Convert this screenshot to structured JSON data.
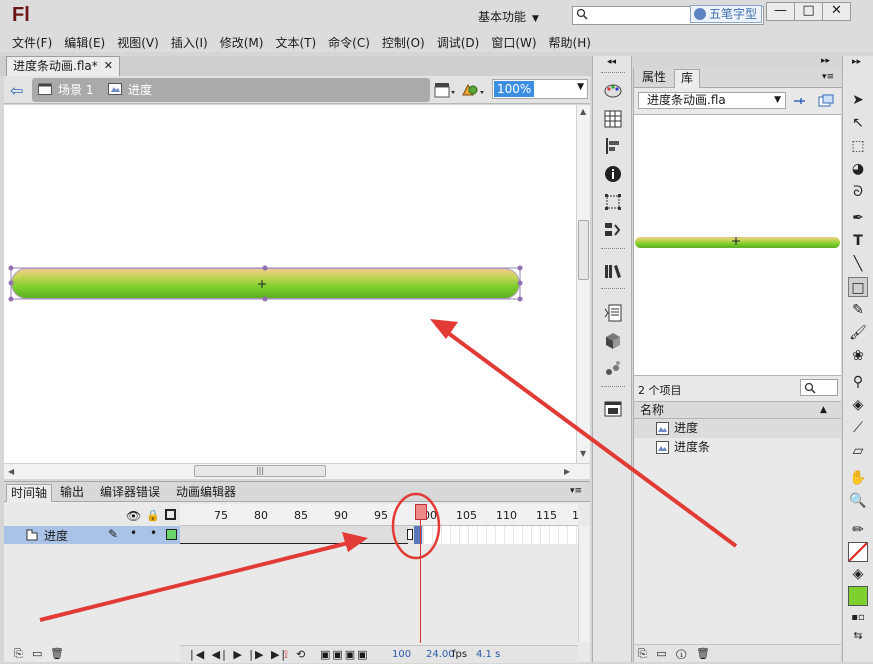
{
  "app": {
    "logo": "Fl",
    "workspace_label": "基本功能",
    "ime_label": "五笔字型",
    "window_buttons": {
      "minimize": "—",
      "restore": "□",
      "close": "✕"
    }
  },
  "menu": [
    "文件(F)",
    "编辑(E)",
    "视图(V)",
    "插入(I)",
    "修改(M)",
    "文本(T)",
    "命令(C)",
    "控制(O)",
    "调试(D)",
    "窗口(W)",
    "帮助(H)"
  ],
  "document": {
    "tab_label": "进度条动画.fla*",
    "tab_close": "✕",
    "breadcrumb": {
      "scene": "场景 1",
      "symbol": "进度"
    },
    "zoom": "100%"
  },
  "timeline": {
    "tabs": [
      "时间轴",
      "输出",
      "编译器错误",
      "动画编辑器"
    ],
    "ruler_ticks": [
      "75",
      "80",
      "85",
      "90",
      "95",
      "100",
      "105",
      "110",
      "115",
      "1"
    ],
    "layer_name": "进度",
    "current_frame": "100",
    "fps": "24.00",
    "fps_unit": "fps",
    "elapsed": "4.1 s"
  },
  "library": {
    "tabs": [
      "属性",
      "库"
    ],
    "document_select": "进度条动画.fla",
    "item_count": "2 个项目",
    "column_header": "名称",
    "items": [
      "进度",
      "进度条"
    ]
  },
  "colors": {
    "accent_blue": "#3b8ee0",
    "layer_highlight": "#a9c3e6",
    "playhead": "#ee8a8a",
    "annotation_red": "#e23b36",
    "bar_green": "#7fcf2e",
    "bar_top": "#f0c98a"
  },
  "icons": {
    "back": "back-arrow-icon",
    "scene": "scene-icon",
    "symbol": "movieclip-symbol-icon",
    "search": "search-icon"
  }
}
